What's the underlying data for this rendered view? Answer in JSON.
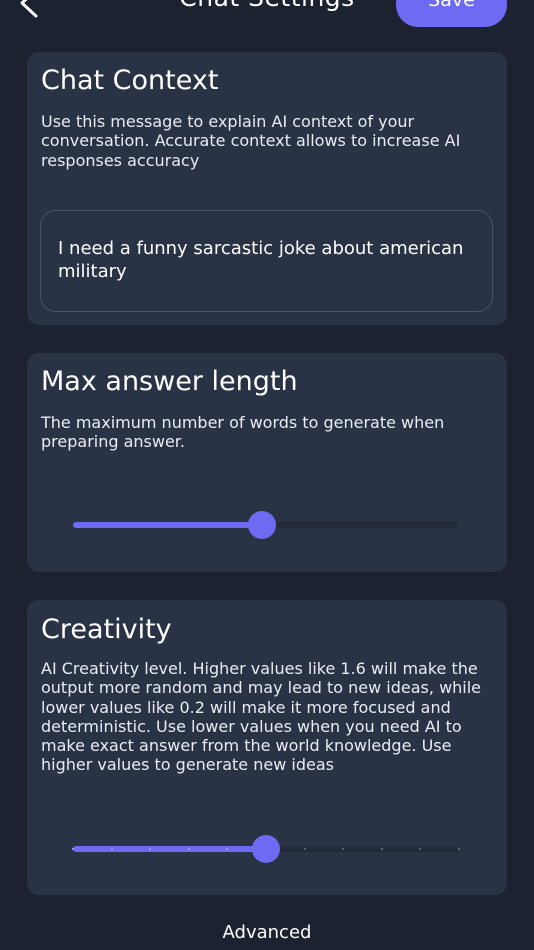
{
  "header": {
    "title": "Chat Settings",
    "save_label": "Save"
  },
  "chat_context": {
    "title": "Chat Context",
    "description": "Use this message to explain AI context of your conversation. Accurate context allows to increase AI responses accuracy",
    "value": "I need a funny sarcastic  joke about american military"
  },
  "max_answer_length": {
    "title": "Max answer length",
    "description": "The maximum number of words to generate when preparing answer.",
    "slider_fraction": 0.49
  },
  "creativity": {
    "title": "Creativity",
    "description": "AI Creativity level. Higher values like 1.6 will make the output more random and may lead to new ideas, while lower values like 0.2 will make it more focused and deterministic. Use lower values when you need AI to make exact answer from the world knowledge. Use higher values to generate new ideas",
    "slider_fraction": 0.5,
    "tick_count": 11
  },
  "footer": {
    "advanced_label": "Advanced"
  },
  "colors": {
    "background": "#1c2230",
    "card": "#2a3246",
    "accent": "#6e6bf2",
    "track": "#232a3a"
  },
  "icons": {
    "back": "chevron-left-icon"
  }
}
